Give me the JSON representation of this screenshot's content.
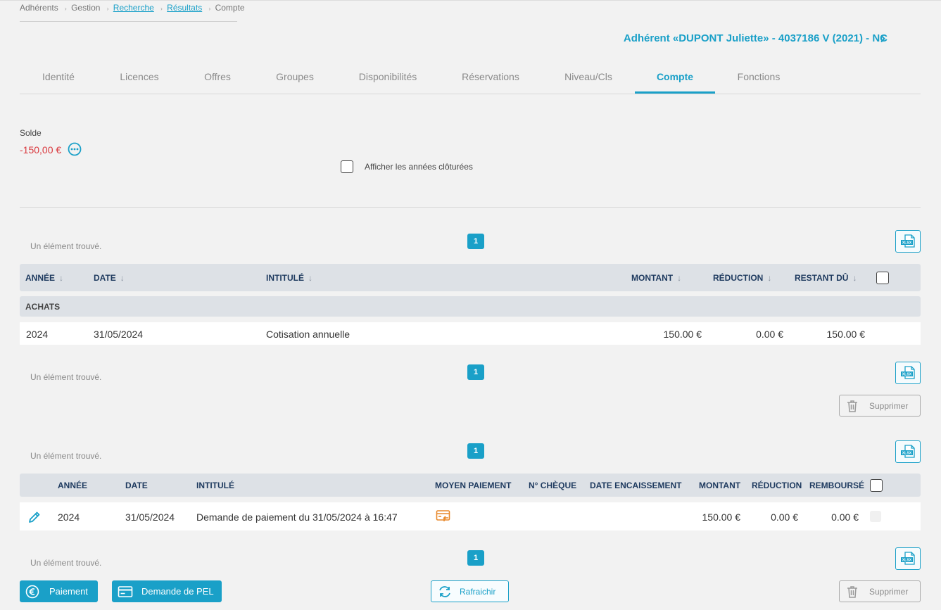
{
  "breadcrumb": {
    "items": [
      {
        "label": "Adhérents"
      },
      {
        "label": "Gestion"
      },
      {
        "label": "Recherche"
      },
      {
        "label": "Résultats"
      },
      {
        "label": "Compte"
      }
    ]
  },
  "member": {
    "title": "Adhérent «DUPONT Juliette» - 4037186 V (2021) - NC"
  },
  "tabs": [
    {
      "label": "Identité"
    },
    {
      "label": "Licences"
    },
    {
      "label": "Offres"
    },
    {
      "label": "Groupes"
    },
    {
      "label": "Disponibilités"
    },
    {
      "label": "Réservations"
    },
    {
      "label": "Niveau/Cls"
    },
    {
      "label": "Compte",
      "active": true
    },
    {
      "label": "Fonctions"
    }
  ],
  "solde": {
    "label": "Solde",
    "value": "-150,00 €"
  },
  "filters": {
    "closed_years_label": "Afficher les années clôturées"
  },
  "purchases": {
    "found_top": "Un élément trouvé.",
    "found_bottom": "Un élément trouvé.",
    "page": "1",
    "xlsx_label": "XLSX",
    "columns": [
      "ANNÉE",
      "DATE",
      "INTITULÉ",
      "MONTANT",
      "RÉDUCTION",
      "RESTANT DÛ"
    ],
    "group_label": "ACHATS",
    "rows": [
      {
        "year": "2024",
        "date": "31/05/2024",
        "label": "Cotisation annuelle",
        "amount": "150.00 €",
        "reduction": "0.00 €",
        "remaining": "150.00 €"
      }
    ],
    "delete_label": "Supprimer"
  },
  "payments": {
    "found_top": "Un élément trouvé.",
    "found_bottom": "Un élément trouvé.",
    "page": "1",
    "xlsx_label": "XLSX",
    "columns": [
      "ANNÉE",
      "DATE",
      "INTITULÉ",
      "MOYEN PAIEMENT",
      "N° CHÈQUE",
      "DATE ENCAISSEMENT",
      "MONTANT",
      "RÉDUCTION",
      "REMBOURSÉ"
    ],
    "rows": [
      {
        "year": "2024",
        "date": "31/05/2024",
        "label": "Demande de paiement du 31/05/2024 à 16:47",
        "method_icon": "online-payment-icon",
        "cheque": "",
        "cash_date": "",
        "amount": "150.00 €",
        "reduction": "0.00 €",
        "refunded": "0.00 €"
      }
    ]
  },
  "footer": {
    "payment_label": "Paiement",
    "pel_label": "Demande de PEL",
    "refresh_label": "Rafraichir",
    "delete_label": "Supprimer"
  },
  "colors": {
    "accent": "#1aa0c8",
    "negative": "#d9383d",
    "header_text": "#1e3a5f",
    "payment_icon": "#e8892b"
  }
}
